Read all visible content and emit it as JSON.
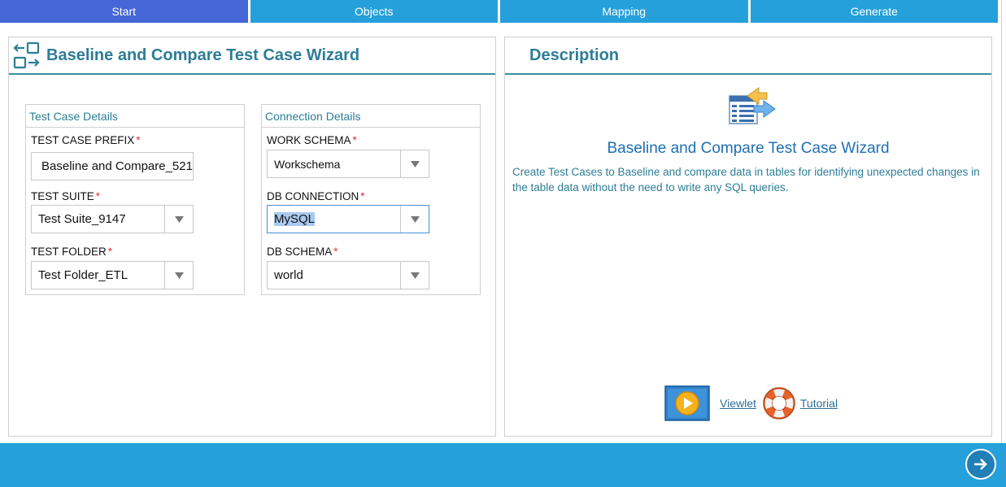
{
  "steps": [
    "Start",
    "Objects",
    "Mapping",
    "Generate"
  ],
  "active_step": "Start",
  "left_panel": {
    "title": "Baseline and Compare Test Case Wizard",
    "test_case_details": {
      "title": "Test Case Details",
      "prefix_label": "TEST CASE PREFIX",
      "prefix_value": "Baseline and Compare_521",
      "suite_label": "TEST SUITE",
      "suite_value": "Test Suite_9147",
      "folder_label": "TEST FOLDER",
      "folder_value": "Test Folder_ETL"
    },
    "connection_details": {
      "title": "Connection Details",
      "work_schema_label": "WORK SCHEMA",
      "work_schema_value": "Workschema",
      "db_connection_label": "DB CONNECTION",
      "db_connection_value": "MySQL",
      "db_schema_label": "DB SCHEMA",
      "db_schema_value": "world"
    },
    "required_mark": "*"
  },
  "right_panel": {
    "title": "Description",
    "heading": "Baseline and Compare Test Case Wizard",
    "text": "Create Test Cases to Baseline and compare data in tables for identifying unexpected changes in the table data without the need to write any SQL queries.",
    "viewlet_link": "Viewlet",
    "tutorial_link": "Tutorial"
  },
  "colors": {
    "tab": "#26a0da",
    "tab_active": "#4466d6",
    "title": "#2d7d96",
    "footer": "#26a0da"
  },
  "icons": {
    "wizard": "wizard-flow-icon",
    "description": "table-arrows-icon",
    "viewlet": "play-icon",
    "tutorial": "lifebuoy-icon",
    "next": "arrow-right-circle-icon"
  }
}
